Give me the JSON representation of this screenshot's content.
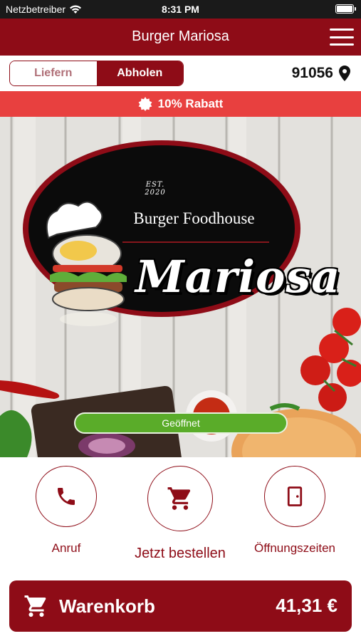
{
  "status_bar": {
    "carrier": "Netzbetreiber",
    "time": "8:31 PM"
  },
  "header": {
    "title": "Burger Mariosa"
  },
  "mode": {
    "deliver": "Liefern",
    "pickup": "Abholen",
    "selected": "Abholen"
  },
  "location": {
    "postal_code": "91056"
  },
  "discount": {
    "text": "10% Rabatt"
  },
  "logo": {
    "est": "EST. 2020",
    "subtitle": "Burger Foodhouse",
    "name": "Mariosa"
  },
  "status_pill": {
    "text": "Geöffnet"
  },
  "actions": [
    {
      "label": "Anruf",
      "icon": "phone-icon"
    },
    {
      "label": "Jetzt bestellen",
      "icon": "cart-icon"
    },
    {
      "label": "Öffnungszeiten",
      "icon": "door-icon"
    }
  ],
  "cart": {
    "label": "Warenkorb",
    "total": "41,31 €"
  },
  "colors": {
    "primary": "#8e0c17",
    "discount": "#e8403f",
    "open": "#5aac29"
  }
}
